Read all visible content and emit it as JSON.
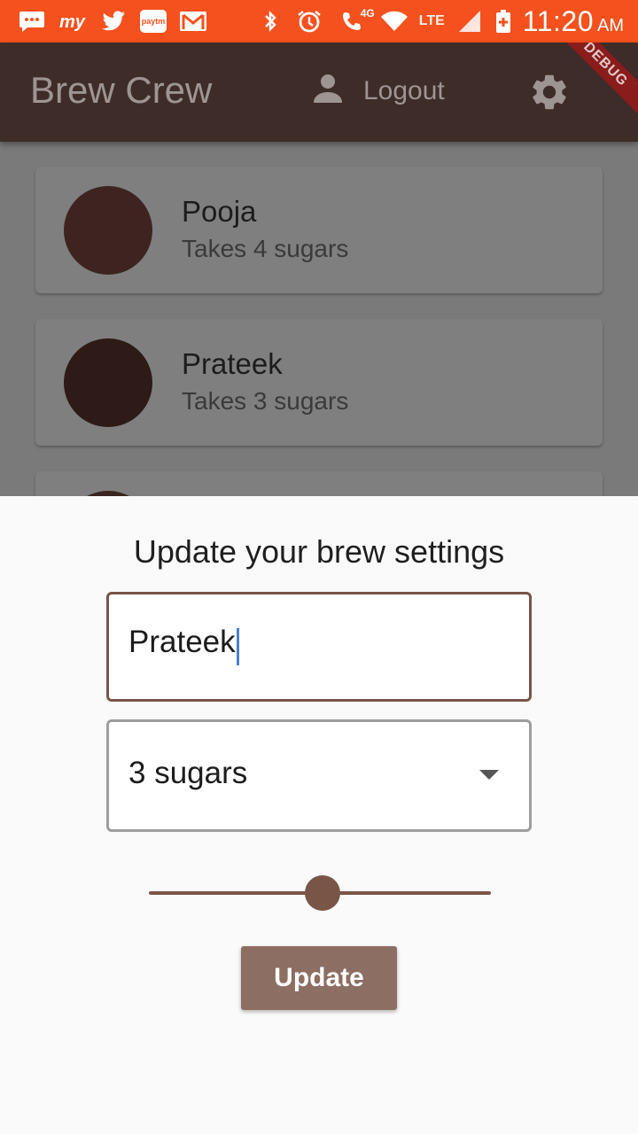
{
  "status_bar": {
    "icons": [
      "messages-icon",
      "myntra-icon",
      "twitter-icon",
      "paytm-icon",
      "gmail-icon",
      "bluetooth-icon",
      "alarm-icon",
      "call-4g-icon",
      "wifi-icon",
      "signal-icon",
      "battery-icon"
    ],
    "paytm_label": "paytm",
    "network_4g": "4G",
    "network_lte": "LTE",
    "time": "11:20",
    "ampm": "AM",
    "background": "#f4511e"
  },
  "app_bar": {
    "title": "Brew Crew",
    "logout_label": "Logout",
    "debug_banner": "DEBUG",
    "background": "#3e2c29"
  },
  "brews": [
    {
      "name": "Pooja",
      "subtitle": "Takes 4 sugars",
      "avatar_color": "#3e2420"
    },
    {
      "name": "Prateek",
      "subtitle": "Takes 3 sugars",
      "avatar_color": "#2e1a17"
    }
  ],
  "sheet": {
    "title": "Update your brew settings",
    "name_value": "Prateek",
    "sugars_value": "3 sugars",
    "strength_fraction": 0.5,
    "update_label": "Update",
    "accent": "#795548",
    "button_color": "#8d6e63"
  }
}
